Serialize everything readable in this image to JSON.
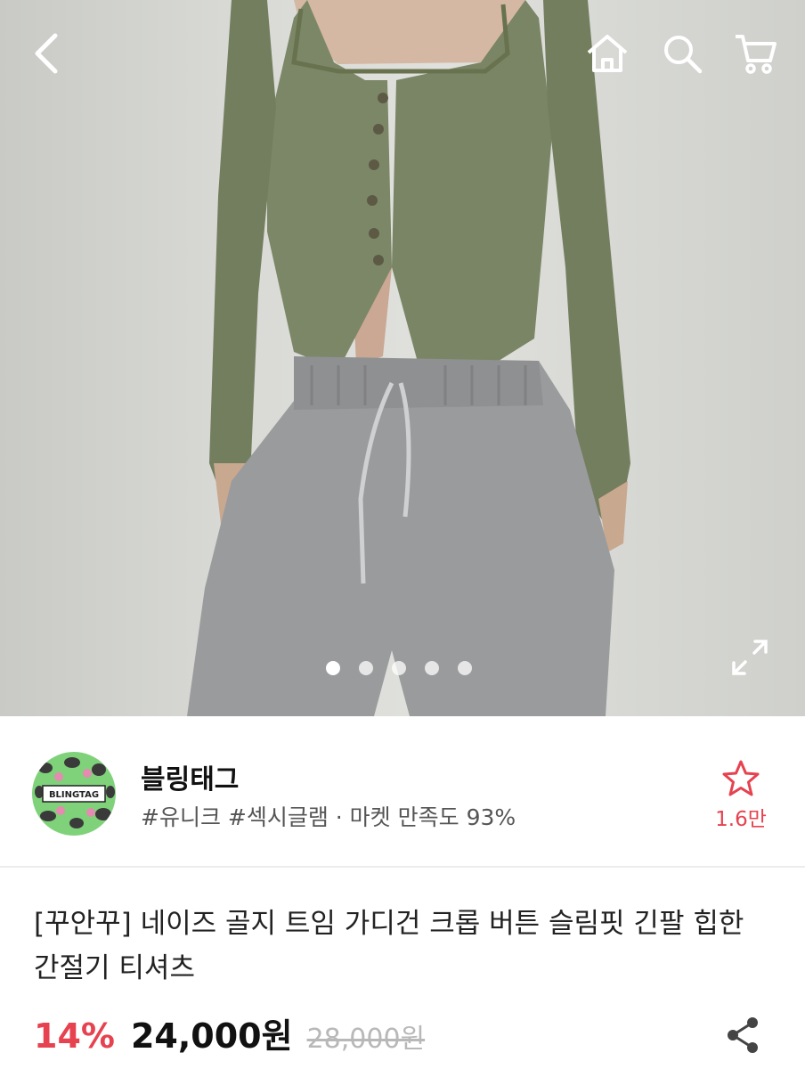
{
  "gallery": {
    "image_alt": "상품 이미지",
    "slide_count": 5,
    "active_slide": 1
  },
  "header_icons": [
    "back-icon",
    "home-icon",
    "search-icon",
    "cart-icon"
  ],
  "shop": {
    "name": "블링태그",
    "logo_text": "BLINGTAG",
    "meta": "#유니크 #섹시글램 · 마켓 만족도 93%",
    "favorite_count": "1.6만"
  },
  "product": {
    "title": "[꾸안꾸] 네이즈 골지 트임 가디건 크롭 버튼 슬림핏 긴팔 힙한 간절기 티셔츠",
    "discount": "14%",
    "price": "24,000원",
    "original_price": "28,000원"
  },
  "colors": {
    "accent": "#e6424f",
    "top_garment": "#7c8767",
    "pants": "#9a9b9d"
  }
}
